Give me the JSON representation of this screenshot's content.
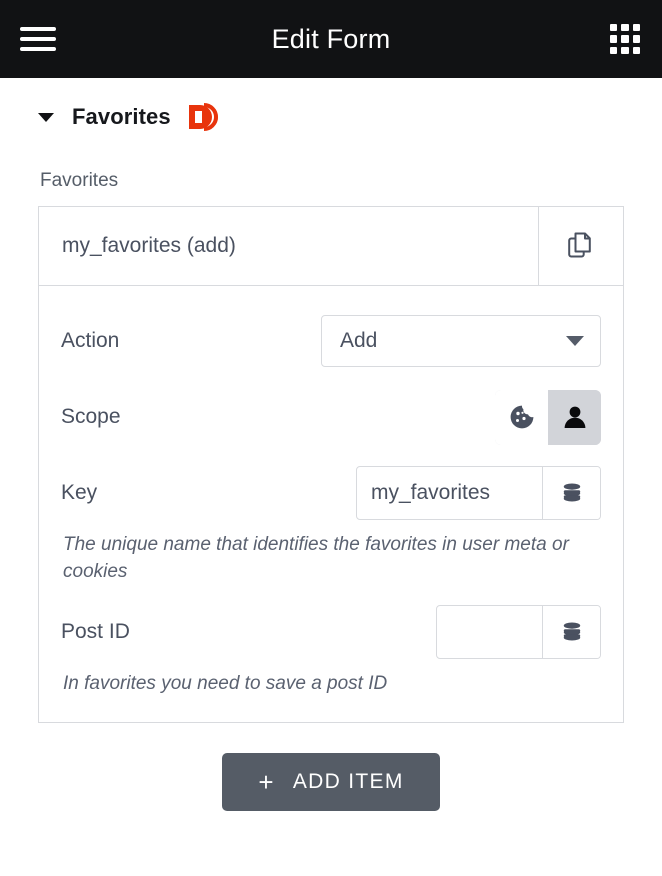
{
  "topbar": {
    "menu_icon": "hamburger-menu-icon",
    "title": "Edit Form",
    "apps_icon": "grid-apps-icon"
  },
  "section": {
    "toggle_icon": "caret-down-icon",
    "title": "Favorites",
    "logo_alt": "crocoblock-d-logo",
    "logo_color": "#e8340c"
  },
  "field": {
    "label": "Favorites"
  },
  "repeater": {
    "item_title": "my_favorites (add)",
    "copy_icon": "copy-icon",
    "rows": {
      "action": {
        "label": "Action",
        "value": "Add",
        "caret_icon": "select-caret-down-icon"
      },
      "scope": {
        "label": "Scope",
        "options": [
          {
            "icon": "cookie-icon",
            "active": false
          },
          {
            "icon": "user-icon",
            "active": true
          }
        ]
      },
      "key": {
        "label": "Key",
        "value": "my_favorites",
        "placeholder": "",
        "addon_icon": "database-icon",
        "help": "The unique name that identifies the favorites in user meta or cookies"
      },
      "post_id": {
        "label": "Post ID",
        "value": "",
        "placeholder": "",
        "addon_icon": "database-icon",
        "help": "In favorites you need to save a post ID"
      }
    }
  },
  "footer": {
    "add_item_label": "ADD ITEM",
    "add_item_plus": "+"
  }
}
